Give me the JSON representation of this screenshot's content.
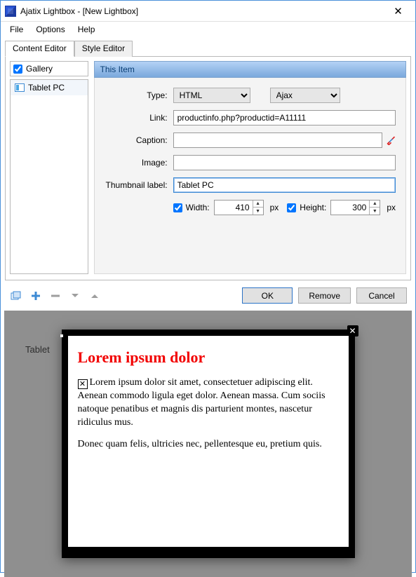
{
  "window": {
    "title": "Ajatix Lightbox - [New Lightbox]"
  },
  "menu": {
    "file": "File",
    "options": "Options",
    "help": "Help"
  },
  "tabs": {
    "content": "Content Editor",
    "style": "Style Editor"
  },
  "gallery": {
    "label": "Gallery",
    "checked": true,
    "items": [
      "Tablet PC"
    ]
  },
  "thisitem": {
    "header": "This Item",
    "labels": {
      "type": "Type:",
      "link": "Link:",
      "caption": "Caption:",
      "image": "Image:",
      "thumb": "Thumbnail label:",
      "width": "Width:",
      "height": "Height:"
    },
    "type_value": "HTML",
    "ajax_value": "Ajax",
    "link": "productinfo.php?productid=A11111",
    "caption": "",
    "image": "",
    "thumb": "Tablet PC",
    "width_checked": true,
    "width": "410",
    "height_checked": true,
    "height": "300",
    "px": "px"
  },
  "buttons": {
    "ok": "OK",
    "remove": "Remove",
    "cancel": "Cancel"
  },
  "preview": {
    "thumb_caption": "Tablet",
    "lightbox": {
      "title": "Lorem ipsum dolor",
      "p1": "Lorem ipsum dolor sit amet, consectetuer adipiscing elit. Aenean commodo ligula eget dolor. Aenean massa. Cum sociis natoque penatibus et magnis dis parturient montes, nascetur ridiculus mus.",
      "p2": "Donec quam felis, ultricies nec, pellentesque eu, pretium quis."
    }
  }
}
